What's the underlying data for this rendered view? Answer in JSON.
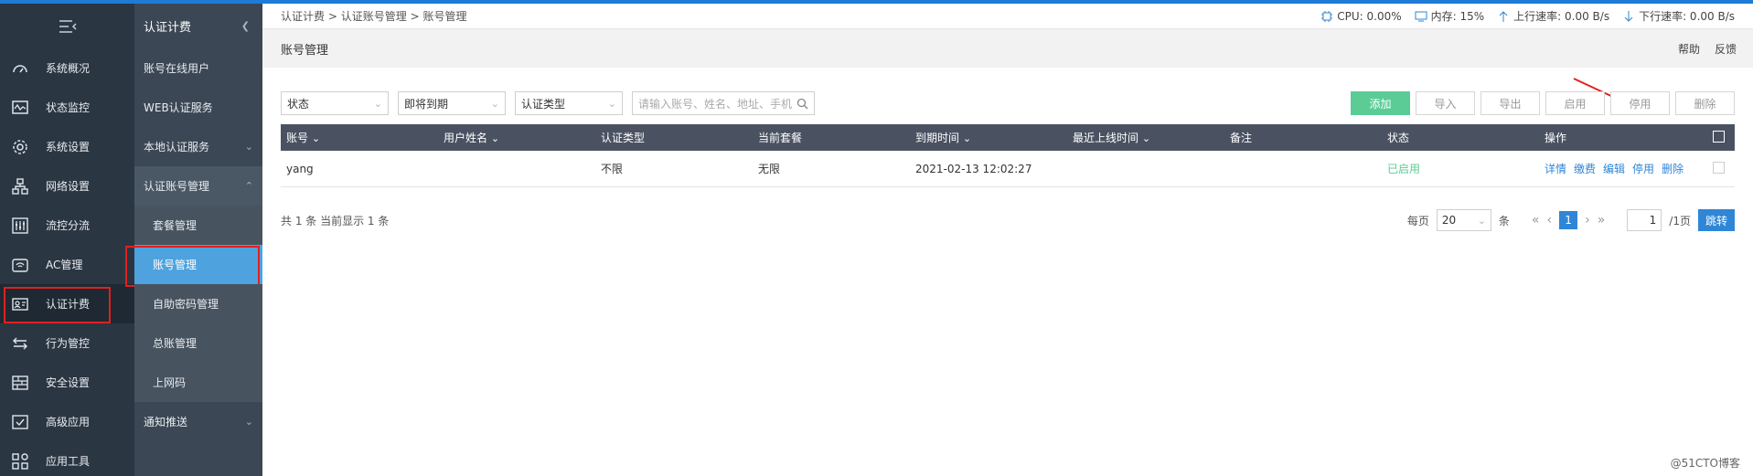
{
  "breadcrumb": [
    "认证计费",
    "认证账号管理",
    "账号管理"
  ],
  "breadcrumb_sep": ">",
  "stats": {
    "cpu": "CPU: 0.00%",
    "mem": "内存: 15%",
    "up": "上行速率: 0.00 B/s",
    "down": "下行速率: 0.00 B/s"
  },
  "title": "账号管理",
  "title_links": [
    "帮助",
    "反馈"
  ],
  "sidebar": {
    "items": [
      {
        "label": "系统概况",
        "icon": "dashboard-icon"
      },
      {
        "label": "状态监控",
        "icon": "monitor-icon"
      },
      {
        "label": "系统设置",
        "icon": "gear-icon"
      },
      {
        "label": "网络设置",
        "icon": "network-icon"
      },
      {
        "label": "流控分流",
        "icon": "sliders-icon"
      },
      {
        "label": "AC管理",
        "icon": "wifi-icon"
      },
      {
        "label": "认证计费",
        "icon": "id-card-icon"
      },
      {
        "label": "行为管控",
        "icon": "swap-icon"
      },
      {
        "label": "安全设置",
        "icon": "firewall-icon"
      },
      {
        "label": "高级应用",
        "icon": "check-window-icon"
      },
      {
        "label": "应用工具",
        "icon": "apps-icon"
      }
    ]
  },
  "subnav": {
    "title": "认证计费",
    "rows": [
      "账号在线用户",
      "WEB认证服务",
      "本地认证服务",
      "认证账号管理"
    ],
    "subs": [
      "套餐管理",
      "账号管理",
      "自助密码管理",
      "总账管理",
      "上网码"
    ],
    "last": "通知推送"
  },
  "filters": {
    "status": "状态",
    "expire": "即将到期",
    "auth_type": "认证类型",
    "search_placeholder": "请输入账号、姓名、地址、手机"
  },
  "buttons": {
    "add": "添加",
    "import": "导入",
    "export": "导出",
    "enable": "启用",
    "disable": "停用",
    "delete": "删除"
  },
  "table": {
    "headers": [
      "账号",
      "用户姓名",
      "认证类型",
      "当前套餐",
      "到期时间",
      "最近上线时间",
      "备注",
      "状态",
      "操作"
    ],
    "rows": [
      {
        "account": "yang",
        "name": "",
        "auth_type": "不限",
        "plan": "无限",
        "expire": "2021-02-13 12:02:27",
        "last_online": "",
        "remark": "",
        "status": "已启用",
        "ops": [
          "详情",
          "缴费",
          "编辑",
          "停用",
          "删除"
        ]
      }
    ]
  },
  "footer": {
    "summary": "共 1 条 当前显示 1 条",
    "per_page_label": "每页",
    "per_page": "20",
    "unit": "条",
    "page": "1",
    "page_input": "1",
    "total_pages": "/1页",
    "jump": "跳转"
  },
  "watermark": "@51CTO博客",
  "colors": {
    "accent": "#2f86d6",
    "add": "#5bcc96",
    "sidebar": "#2b3643"
  }
}
